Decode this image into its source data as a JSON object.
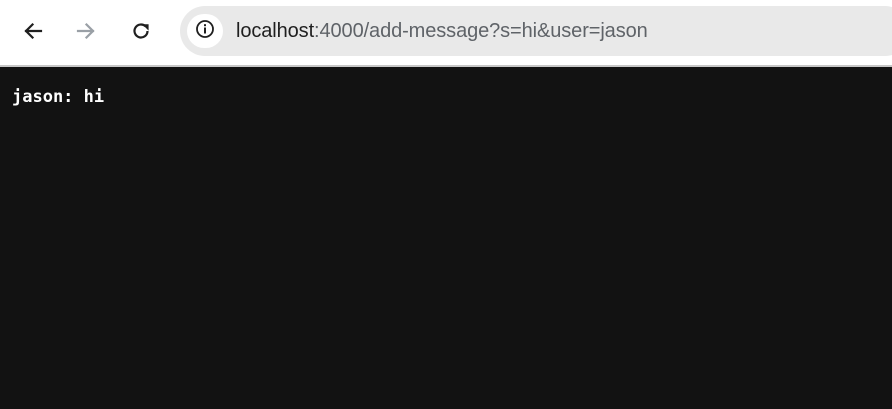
{
  "toolbar": {
    "back_icon": "arrow-left-icon",
    "forward_icon": "arrow-right-icon",
    "reload_icon": "reload-icon",
    "site_info_icon": "info-icon"
  },
  "address_bar": {
    "host": "localhost",
    "rest": ":4000/add-message?s=hi&user=jason"
  },
  "page": {
    "message": "jason: hi"
  },
  "colors": {
    "page_background": "#121212",
    "toolbar_background": "#ffffff",
    "omnibox_background": "#e9e9e9",
    "text_white": "#ffffff",
    "url_host": "#1f1f1f",
    "url_rest": "#5f6368",
    "forward_disabled": "#9aa0a6"
  }
}
